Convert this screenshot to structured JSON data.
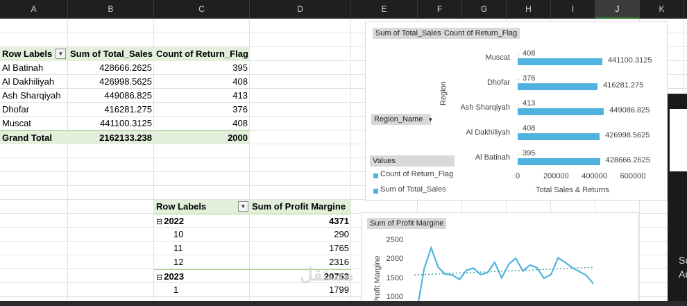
{
  "columns": [
    {
      "label": "A",
      "w": 98
    },
    {
      "label": "B",
      "w": 124
    },
    {
      "label": "C",
      "w": 138
    },
    {
      "label": "D",
      "w": 146
    },
    {
      "label": "E",
      "w": 96
    },
    {
      "label": "F",
      "w": 64
    },
    {
      "label": "G",
      "w": 64
    },
    {
      "label": "H",
      "w": 64
    },
    {
      "label": "I",
      "w": 64
    },
    {
      "label": "J",
      "w": 64
    },
    {
      "label": "K",
      "w": 64
    }
  ],
  "pivot1": {
    "headers": [
      "Row Labels",
      "Sum of Total_Sales",
      "Count of Return_Flag"
    ],
    "rows": [
      {
        "label": "Al Batinah",
        "sales": "428666.2625",
        "returns": "395"
      },
      {
        "label": "Al Dakhiliyah",
        "sales": "426998.5625",
        "returns": "408"
      },
      {
        "label": "Ash Sharqiyah",
        "sales": "449086.825",
        "returns": "413"
      },
      {
        "label": "Dhofar",
        "sales": "416281.275",
        "returns": "376"
      },
      {
        "label": "Muscat",
        "sales": "441100.3125",
        "returns": "408"
      }
    ],
    "total": {
      "label": "Grand Total",
      "sales": "2162133.238",
      "returns": "2000"
    }
  },
  "pivot2": {
    "headers": [
      "Row Labels",
      "Sum of Profit Margine"
    ],
    "rows": [
      {
        "label": "2022",
        "value": "4371",
        "group": true
      },
      {
        "label": "10",
        "value": "290",
        "group": false
      },
      {
        "label": "11",
        "value": "1765",
        "group": false
      },
      {
        "label": "12",
        "value": "2316",
        "group": false
      },
      {
        "label": "2023",
        "value": "20753",
        "group": true
      },
      {
        "label": "1",
        "value": "1799",
        "group": false
      }
    ],
    "collapse_icon": "minus-box-icon"
  },
  "bar_chart": {
    "field_buttons": [
      "Sum of Total_Sales",
      "Count of Return_Flag"
    ],
    "row_field": "Region_Name",
    "values_label": "Values",
    "legend": [
      "Count of Return_Flag",
      "Sum of Total_Sales"
    ],
    "y_title": "Region",
    "x_title": "Total Sales & Returns"
  },
  "line_chart": {
    "field_button": "Sum of Profit Margine",
    "y_title": "Profit Margine",
    "y_ticks": [
      "2500",
      "2000",
      "1500",
      "1000"
    ]
  },
  "chart_data": [
    {
      "type": "bar",
      "orientation": "horizontal",
      "categories": [
        "Muscat",
        "Dhofar",
        "Ash Sharqiyah",
        "Al Dakhiliyah",
        "Al Batinah"
      ],
      "series": [
        {
          "name": "Count of Return_Flag",
          "values": [
            408,
            376,
            413,
            408,
            395
          ]
        },
        {
          "name": "Sum of Total_Sales",
          "values": [
            441100.3125,
            416281.275,
            449086.825,
            426998.5625,
            428666.2625
          ]
        }
      ],
      "xlabel": "Total Sales & Returns",
      "ylabel": "Region",
      "x_ticks": [
        "0",
        "200000",
        "400000",
        "600000"
      ],
      "xlim": [
        0,
        600000
      ],
      "legend": "left"
    },
    {
      "type": "line",
      "series": [
        {
          "name": "Sum of Profit Margine",
          "values": [
            290,
            1765,
            2316,
            1799,
            1620,
            1600,
            1480,
            1720,
            1780,
            1610,
            1660,
            1930,
            1520,
            1880,
            2040,
            1700,
            1860,
            1790,
            1510,
            1610,
            2050,
            1930,
            1790,
            1690,
            1590,
            1370
          ]
        }
      ],
      "trendline": true,
      "ylabel": "Profit Margine",
      "ylim": [
        1000,
        2500
      ],
      "y_ticks": [
        2500,
        2000,
        1500,
        1000
      ]
    }
  ],
  "colors": {
    "bar": "#4fb3e0",
    "pivot_header": "#e2efda",
    "line": "#4fb3e0",
    "trend": "#3aa7a0"
  },
  "side_app": {
    "text1": "Sc",
    "text2": "Au"
  },
  "watermark": "مستقل"
}
